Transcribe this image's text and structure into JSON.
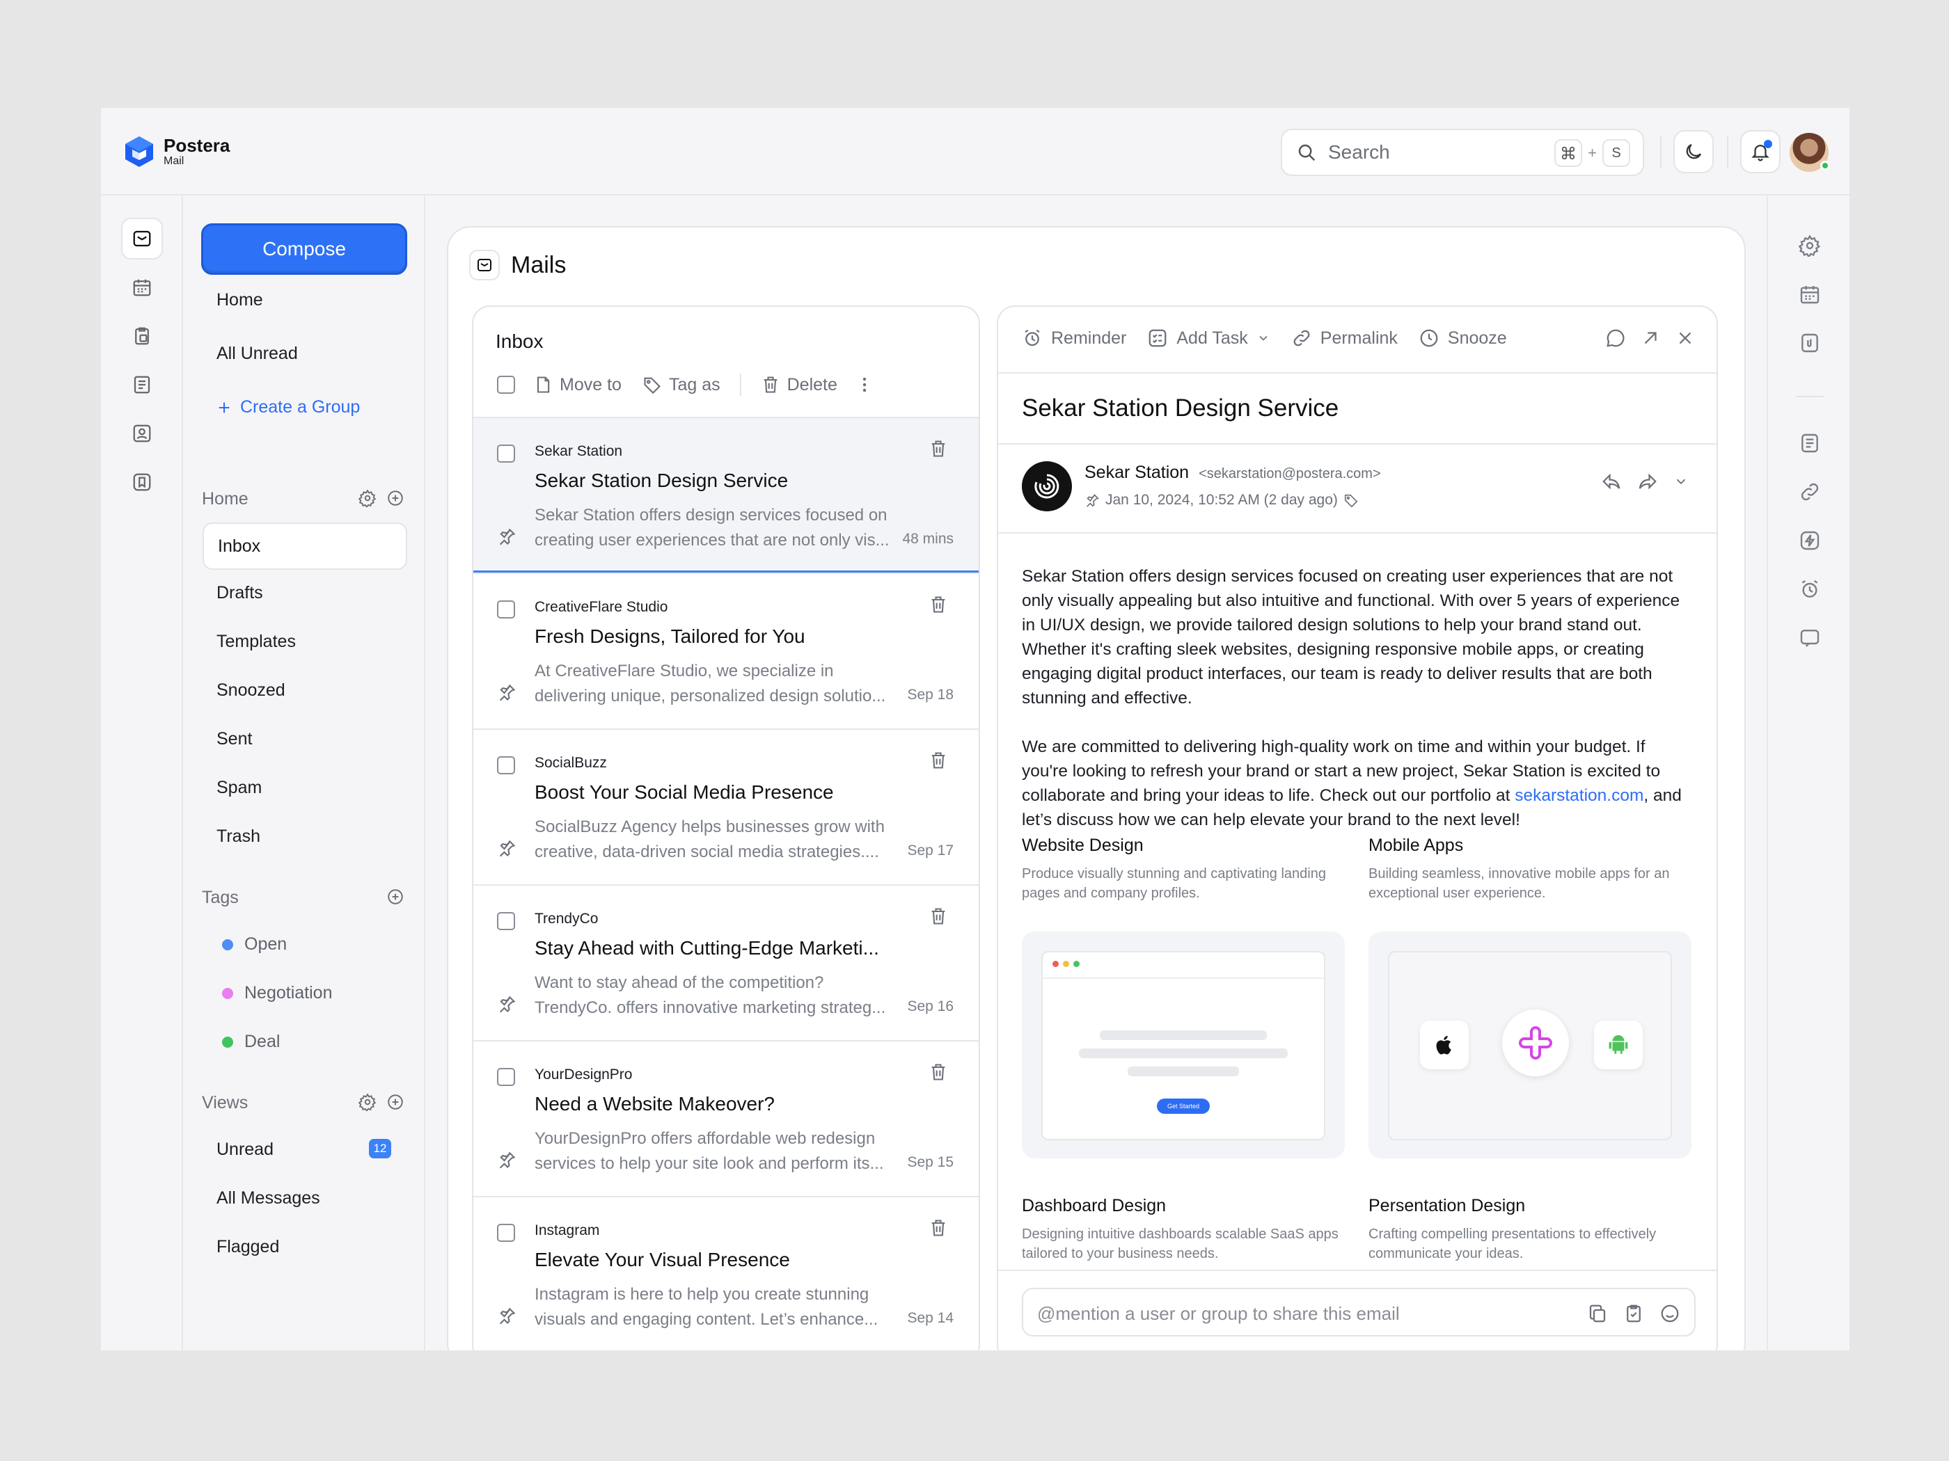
{
  "app": {
    "name": "Postera",
    "sub": "Mail"
  },
  "header": {
    "search_placeholder": "Search",
    "shortcut_plus": "+",
    "shortcut_key": "S"
  },
  "sidebar": {
    "compose": "Compose",
    "top": [
      "Home",
      "All Unread"
    ],
    "create_group": "Create a Group",
    "home_section": "Home",
    "folders": [
      "Inbox",
      "Drafts",
      "Templates",
      "Snoozed",
      "Sent",
      "Spam",
      "Trash"
    ],
    "tags_section": "Tags",
    "tags": [
      {
        "label": "Open",
        "color": "#4f8df7"
      },
      {
        "label": "Negotiation",
        "color": "#e97ef0"
      },
      {
        "label": "Deal",
        "color": "#3fc45f"
      }
    ],
    "views_section": "Views",
    "views": [
      "Unread",
      "All Messages",
      "Flagged"
    ],
    "unread_count": "12"
  },
  "main": {
    "title": "Mails"
  },
  "inbox": {
    "title": "Inbox",
    "toolbar": {
      "move": "Move to",
      "tag": "Tag as",
      "delete": "Delete"
    },
    "mails": [
      {
        "sender": "Sekar Station",
        "subject": "Sekar Station Design Service",
        "preview": "Sekar Station offers design services focused on creating user experiences that are not only vis...",
        "date": "48 mins"
      },
      {
        "sender": "CreativeFlare Studio",
        "subject": "Fresh Designs, Tailored for You",
        "preview": "At CreativeFlare Studio, we specialize in delivering unique, personalized design solutio...",
        "date": "Sep 18"
      },
      {
        "sender": "SocialBuzz",
        "subject": "Boost Your Social Media Presence",
        "preview": "SocialBuzz Agency helps businesses grow with creative, data-driven social media strategies....",
        "date": "Sep 17"
      },
      {
        "sender": "TrendyCo",
        "subject": "Stay Ahead with Cutting-Edge Marketi...",
        "preview": "Want to stay ahead of the competition? TrendyCo. offers innovative marketing strateg...",
        "date": "Sep 16"
      },
      {
        "sender": "YourDesignPro",
        "subject": "Need a Website Makeover?",
        "preview": "YourDesignPro offers affordable web redesign services to help your site look and perform its...",
        "date": "Sep 15"
      },
      {
        "sender": "Instagram",
        "subject": "Elevate Your Visual Presence",
        "preview": "Instagram is here to help you create stunning visuals and engaging content. Let’s enhance...",
        "date": "Sep 14"
      }
    ]
  },
  "detail": {
    "toolbar": {
      "reminder": "Reminder",
      "add_task": "Add Task",
      "permalink": "Permalink",
      "snooze": "Snooze"
    },
    "subject": "Sekar Station Design Service",
    "from_name": "Sekar Station",
    "from_email": "<sekarstation@postera.com>",
    "date": "Jan 10, 2024, 10:52 AM (2 day ago)",
    "body_1": "Sekar Station offers design services focused on creating user experiences that are not only visually appealing but also intuitive and functional. With over 5 years of experience in UI/UX design, we provide tailored design solutions to help your brand stand out. Whether it's crafting sleek websites, designing responsive mobile apps, or creating engaging digital product interfaces, our team is ready to deliver results that are both stunning and effective.",
    "body_2_pre": "We are committed to delivering high-quality work on time and within your budget. If you're looking to refresh your brand or start a new project, Sekar Station is excited to collaborate and bring your ideas to life. Check out our portfolio at ",
    "body_2_link": "sekarstation.com",
    "body_2_post": ", and let’s discuss how we can help elevate your brand to the next level!",
    "services": [
      {
        "title": "Website Design",
        "desc": "Produce visually stunning and captivating landing pages and company profiles."
      },
      {
        "title": "Mobile Apps",
        "desc": "Building seamless, innovative mobile apps for an exceptional user experience."
      },
      {
        "title": "Dashboard Design",
        "desc": "Designing intuitive dashboards scalable SaaS apps tailored to your business needs."
      },
      {
        "title": "Persentation Design",
        "desc": "Crafting compelling presentations to effectively communicate your ideas."
      }
    ],
    "mock_button": "Get Started",
    "share_placeholder": "@mention a user or group to share this email"
  }
}
